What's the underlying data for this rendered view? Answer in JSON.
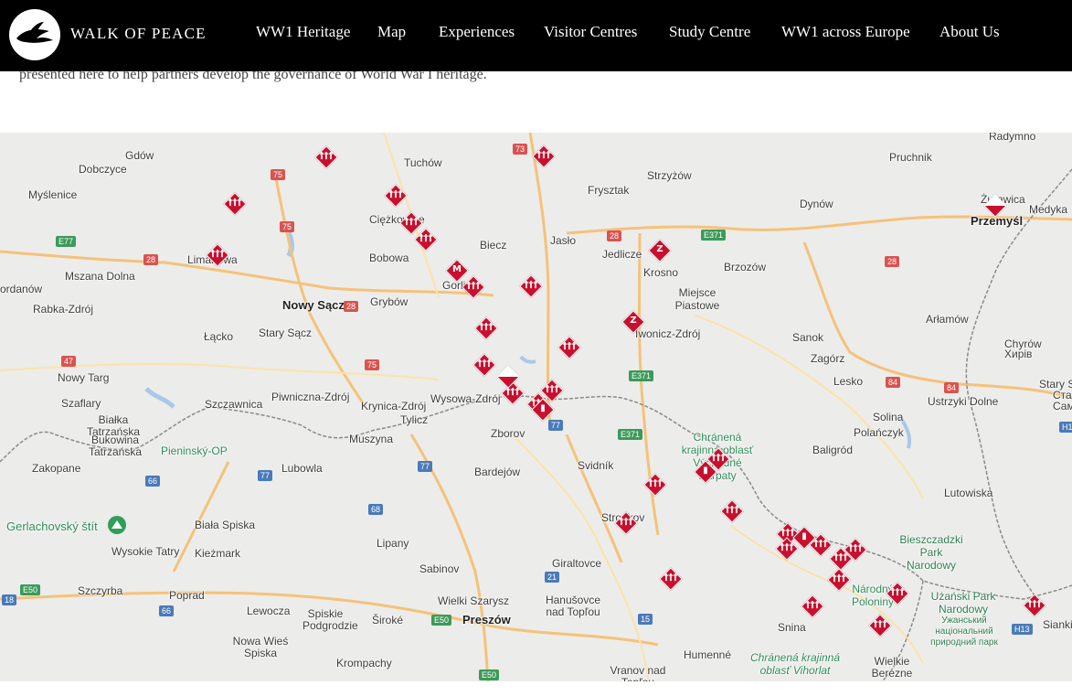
{
  "header": {
    "logo_text": "WALK OF PEACE",
    "nav": [
      "WW1 Heritage",
      "Map",
      "Experiences",
      "Visitor Centres",
      "Study Centre",
      "WW1 across Europe",
      "About Us"
    ]
  },
  "intro_text": "presented here to help partners develop the governance of World War I heritage.",
  "map": {
    "places": [
      {
        "t": "Gdów"
      },
      {
        "t": "Dobczyce"
      },
      {
        "t": "Myślenice"
      },
      {
        "t": "Tuchów"
      },
      {
        "t": "Ciężkowice"
      },
      {
        "t": "Bobowa"
      },
      {
        "t": "Biecz"
      },
      {
        "t": "Jasło"
      },
      {
        "t": "Frysztak"
      },
      {
        "t": "Strzyżów"
      },
      {
        "t": "Jedlicze"
      },
      {
        "t": "Krosno"
      },
      {
        "t": "Miejsce Piastowe"
      },
      {
        "t": "Brzozów"
      },
      {
        "t": "Dynów"
      },
      {
        "t": "Pruchnik"
      },
      {
        "t": "Radymno"
      },
      {
        "t": "Żurawica"
      },
      {
        "t": "Przemyśl"
      },
      {
        "t": "Medyka"
      },
      {
        "t": "Limanowa"
      },
      {
        "t": "Mszana Dolna"
      },
      {
        "t": "Nowy Sącz"
      },
      {
        "t": "Grybów"
      },
      {
        "t": "Gorlice"
      },
      {
        "t": "ordanów"
      },
      {
        "t": "Rabka-Zdrój"
      },
      {
        "t": "Łącko"
      },
      {
        "t": "Stary Sącz"
      },
      {
        "t": "Nowy Targ"
      },
      {
        "t": "Szczawnica"
      },
      {
        "t": "Piwniczna-Zdrój"
      },
      {
        "t": "Krynica-Zdrój"
      },
      {
        "t": "Wysowa-Zdrój"
      },
      {
        "t": "Tylicz"
      },
      {
        "t": "Iwonicz-Zdrój"
      },
      {
        "t": "Sanok"
      },
      {
        "t": "Zagórz"
      },
      {
        "t": "Arłamów"
      },
      {
        "t": "Chyrów"
      },
      {
        "t": "Хирів"
      },
      {
        "t": "Lesko"
      },
      {
        "t": "Ustrzyki Dolne"
      },
      {
        "t": "Stary S"
      },
      {
        "t": "Ста"
      },
      {
        "t": "Сам"
      },
      {
        "t": "Szaflary"
      },
      {
        "t": "Białka Tatrzańska"
      },
      {
        "t": "Bukowina Tatrzańska"
      },
      {
        "t": "Muszyna"
      },
      {
        "t": "Zborov"
      },
      {
        "t": "Solina"
      },
      {
        "t": "Polańczyk"
      },
      {
        "t": "Baligród"
      },
      {
        "t": "Zakopane"
      },
      {
        "t": "Lubowla"
      },
      {
        "t": "Bardejów"
      },
      {
        "t": "Svidník"
      },
      {
        "t": "Lutowiska"
      },
      {
        "t": "Gerlachovský štít"
      },
      {
        "t": "Wysokie Tatry"
      },
      {
        "t": "Biała Spiska"
      },
      {
        "t": "Kieżmark"
      },
      {
        "t": "Lipany"
      },
      {
        "t": "Stropkov"
      },
      {
        "t": "Sabinov"
      },
      {
        "t": "Giraltovce"
      },
      {
        "t": "Szczyrba"
      },
      {
        "t": "Poprad"
      },
      {
        "t": "Lewocza"
      },
      {
        "t": "Spiskie Podgrodzie"
      },
      {
        "t": "Wielki Szarysz"
      },
      {
        "t": "Hanušovce nad Topľou"
      },
      {
        "t": "Preszów"
      },
      {
        "t": "Snina"
      },
      {
        "t": "Nowa Wieś Spiska"
      },
      {
        "t": "Široké"
      },
      {
        "t": "Krompachy"
      },
      {
        "t": "Vranov nad Topľou"
      },
      {
        "t": "Humenné"
      },
      {
        "t": "Wielkie Berezne"
      },
      {
        "t": "Sianki"
      }
    ],
    "green_labels": [
      "Pieninský-OP",
      "Chránená krajinná oblasť Východné Karpaty",
      "Národný Poloniny",
      "Chránená krajinná oblasť Vihorlat",
      "Bieszczadzki Park Narodowy",
      "Użański Park Narodowy",
      "Ужанський національний природний парк"
    ],
    "shields": [
      "73",
      "75",
      "75",
      "E77",
      "28",
      "28",
      "28",
      "28",
      "47",
      "75",
      "E371",
      "E371",
      "E371",
      "77",
      "77",
      "77",
      "66",
      "68",
      "21",
      "15",
      "18",
      "E50",
      "66",
      "E50",
      "E50",
      "84",
      "84",
      "H1",
      "H13"
    ],
    "markers": [
      {
        "sym": "†††"
      },
      {
        "sym": "†††"
      },
      {
        "sym": "†††"
      },
      {
        "sym": "†††"
      },
      {
        "sym": "†††"
      },
      {
        "sym": "†††"
      },
      {
        "sym": "†††"
      },
      {
        "sym": "M"
      },
      {
        "sym": "†††"
      },
      {
        "sym": "†††"
      },
      {
        "sym": "Z"
      },
      {
        "sym": "Z"
      },
      {
        "sym": "†††"
      },
      {
        "sym": "†††"
      },
      {
        "sym": "†††"
      },
      {
        "sym": "†††"
      },
      {
        "sym": "flag"
      },
      {
        "sym": "†††"
      },
      {
        "sym": "†††"
      },
      {
        "sym": "▮"
      },
      {
        "sym": "†††"
      },
      {
        "sym": "†††"
      },
      {
        "sym": "▮"
      },
      {
        "sym": "†††"
      },
      {
        "sym": "†††"
      },
      {
        "sym": "†††"
      },
      {
        "sym": "†††"
      },
      {
        "sym": "†††"
      },
      {
        "sym": "▮"
      },
      {
        "sym": "†††"
      },
      {
        "sym": "†††"
      },
      {
        "sym": "†††"
      },
      {
        "sym": "†††"
      },
      {
        "sym": "†††"
      },
      {
        "sym": "†††"
      },
      {
        "sym": "†††"
      },
      {
        "sym": "†††"
      },
      {
        "sym": "flag"
      }
    ]
  }
}
